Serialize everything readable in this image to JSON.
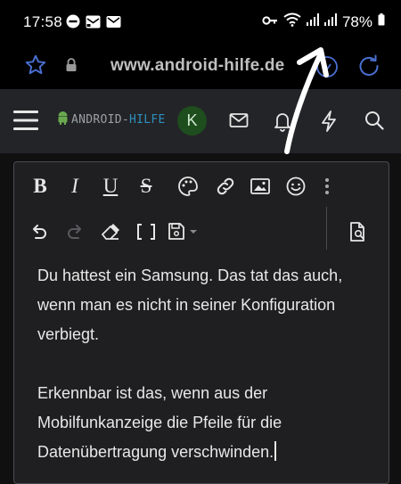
{
  "status": {
    "time": "17:58",
    "battery": "78%"
  },
  "browser": {
    "url": "www.android-hilfe.de"
  },
  "forum": {
    "logo_main": "ANDROID-",
    "logo_accent": "HILFE",
    "avatar_letter": "K"
  },
  "editor": {
    "toolbar": {
      "bold": "B",
      "italic": "I",
      "underline": "U",
      "strike": "S"
    },
    "paragraphs": [
      "Du hattest ein Samsung. Das tat das auch, wenn man es nicht in seiner Konfiguration verbiegt.",
      "Erkennbar ist das, wenn aus der Mobilfunkanzeige die Pfeile für die Datenübertragung verschwinden."
    ]
  },
  "colors": {
    "accent": "#2e8fbd",
    "header_bg": "#232428",
    "editor_bg": "#1f1f21"
  }
}
